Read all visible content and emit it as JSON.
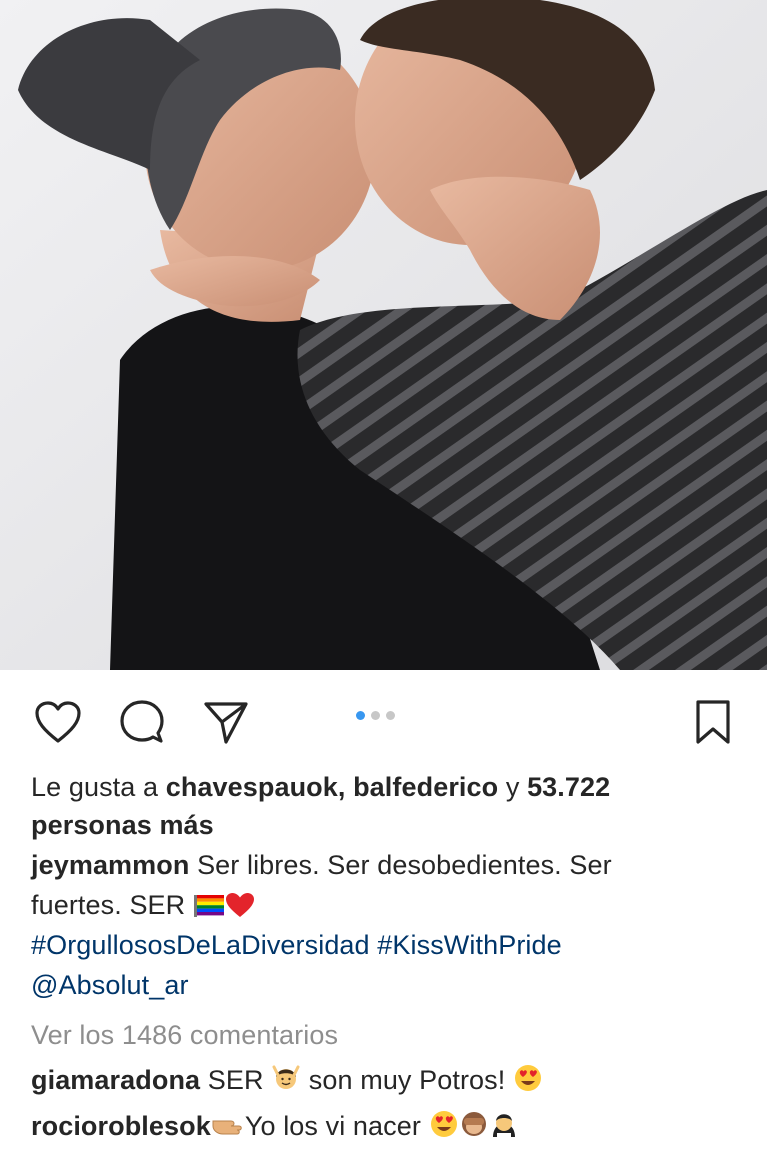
{
  "post": {
    "image_alt": "",
    "carousel": {
      "count": 3,
      "active": 1
    },
    "likes": {
      "prefix": "Le gusta a ",
      "user1": "chavespauok",
      "sep": ", ",
      "user2": "balfederico",
      "conj": " y ",
      "count": "53.722",
      "line2": "personas más"
    },
    "caption": {
      "author": "jeymammon",
      "text1": " Ser libres. Ser desobedientes. Ser",
      "text2": "fuertes.  SER",
      "hashtag1": "#OrgullososDeLaDiversidad",
      "hashtag2": "#KissWithPride",
      "mention": "@Absolut_ar"
    },
    "view_comments": "Ver los 1486 comentarios",
    "comments": [
      {
        "author": "giamaradona",
        "text_a": " SER ",
        "text_b": " son muy Potros! "
      },
      {
        "author": "rocioroblesok",
        "text_a": "Yo los vi nacer "
      }
    ]
  },
  "icons": {
    "like": "heart-outline-icon",
    "comment": "comment-bubble-icon",
    "share": "paper-plane-icon",
    "save": "bookmark-outline-icon"
  },
  "colors": {
    "link": "#003569",
    "muted": "#8e8e8e",
    "dot_active": "#3897f0"
  }
}
